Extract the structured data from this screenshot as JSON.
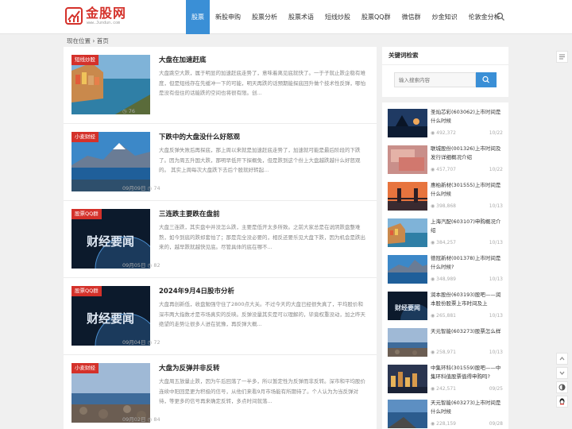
{
  "header": {
    "logo_text": "金股网",
    "logo_sub": "www.Jundun.com",
    "nav": [
      "股票",
      "新股申购",
      "股票分析",
      "股票术语",
      "短线炒股",
      "股票QQ群",
      "微信群",
      "炒金知识",
      "伦敦金分析"
    ]
  },
  "breadcrumb": "现在位置 › 首页",
  "posts": [
    {
      "badge": "短线炒股",
      "title": "大盘在加速赶底",
      "excerpt": "大盘跳空大跌，属于明显的加速赶底走势了，意味着离见底就快了。一于子就止跌企稳有难度，但是短线存在先缓冲一下的可能，明天再跌的话预期能探底回升做个技术性反弹，哪怕是没有但住的话能跌的空间也将很有限。创...",
      "meta": "◷ 76"
    },
    {
      "badge": "小麦财经",
      "title": "下跌中的大盘没什么好怒观",
      "excerpt": "大盘反弹失败后再探底，那上周以来就是加速赶底走势了，加速就可能是最后阶段的下跌了。因为周五升国大跌，那明早低开下探概免，但是跌到这个份上大盘越跌越什么好怒观的。 其实上周每次大盘跌下去后个股就好转起...",
      "meta": "09月09日 ◷ 74"
    },
    {
      "badge": "股票QQ群",
      "title": "三连跌主要跌在盘前",
      "excerpt": "大盘三连跌，其实盘中并没怎么跌，主要是低开太多所致。之前大家总是在说阴跌盘整难熬，如今到底的跌却套怕了；那是完全没必要的，相反还要乐见大盘下跌，因为机会是跌出来的，越早跌就越快见底。尽管具体的底在哪不...",
      "meta": "09月05日 ◷ 82"
    },
    {
      "badge": "股票QQ群",
      "title": "2024年9月4日股市分析",
      "excerpt": "大盘再创新低，收盘勉强守住了2800点大关。不过今天的大盘已经很失真了，平均股价和深市两大指数才是市场真实的反映。反弹没量其实是可以理解的，毕竟权重没动，加之昨天绝望的走势让很多人进在犹豫，再反弹大概...",
      "meta": "09月04日 ◷ 72"
    },
    {
      "badge": "小麦财经",
      "title": "大盘为反弹并非反转",
      "excerpt": "大盘周五放量止跌，因为午后回落了一半多，所以暂定性为反弹而非反转。深市和平均股价连续中阳回是更为积极的信号，从他们来看9月市场能有所期待了。个人认为为当反弹对待，等更多的信号再来确定反转，多点时间就落...",
      "meta": "09月02日 ◷ 84"
    }
  ],
  "sidebar": {
    "search_head": "关键词检索",
    "search_placeholder": "输入搜索内容",
    "items": [
      {
        "title": "圣灿芯彩(603062)上市时间是什么时候",
        "views": "◉ 492,372",
        "date": "10/22"
      },
      {
        "title": "联城股份(001326)上市时间及发行详细概况介绍",
        "views": "◉ 457,707",
        "date": "10/22"
      },
      {
        "title": "惠柏新材(301555)上市时间是什么时候",
        "views": "◉ 398,868",
        "date": "10/13"
      },
      {
        "title": "上海汽配(603107)申购概况介绍",
        "views": "◉ 384,257",
        "date": "10/13"
      },
      {
        "title": "德冠新材(001378)上市时间是什么时候?",
        "views": "◉ 348,989",
        "date": "10/13"
      },
      {
        "title": "润本股份(603193)股吧——润本股份股票上市时间及上",
        "views": "◉ 265,881",
        "date": "10/13"
      },
      {
        "title": "天元智能(603273)股票怎么样",
        "views": "◉ 258,971",
        "date": "10/13"
      },
      {
        "title": "中集环科(301559)股吧——中集环科值股票值得申购吗?",
        "views": "◉ 242,571",
        "date": "09/25"
      },
      {
        "title": "天元智能(603273)上市时间是什么时候",
        "views": "◉ 228,159",
        "date": "09/28"
      }
    ]
  },
  "thumb_overlay_text": "财经要闻",
  "colors": {
    "accent": "#3a8fd6",
    "badge": "#d4312a"
  }
}
